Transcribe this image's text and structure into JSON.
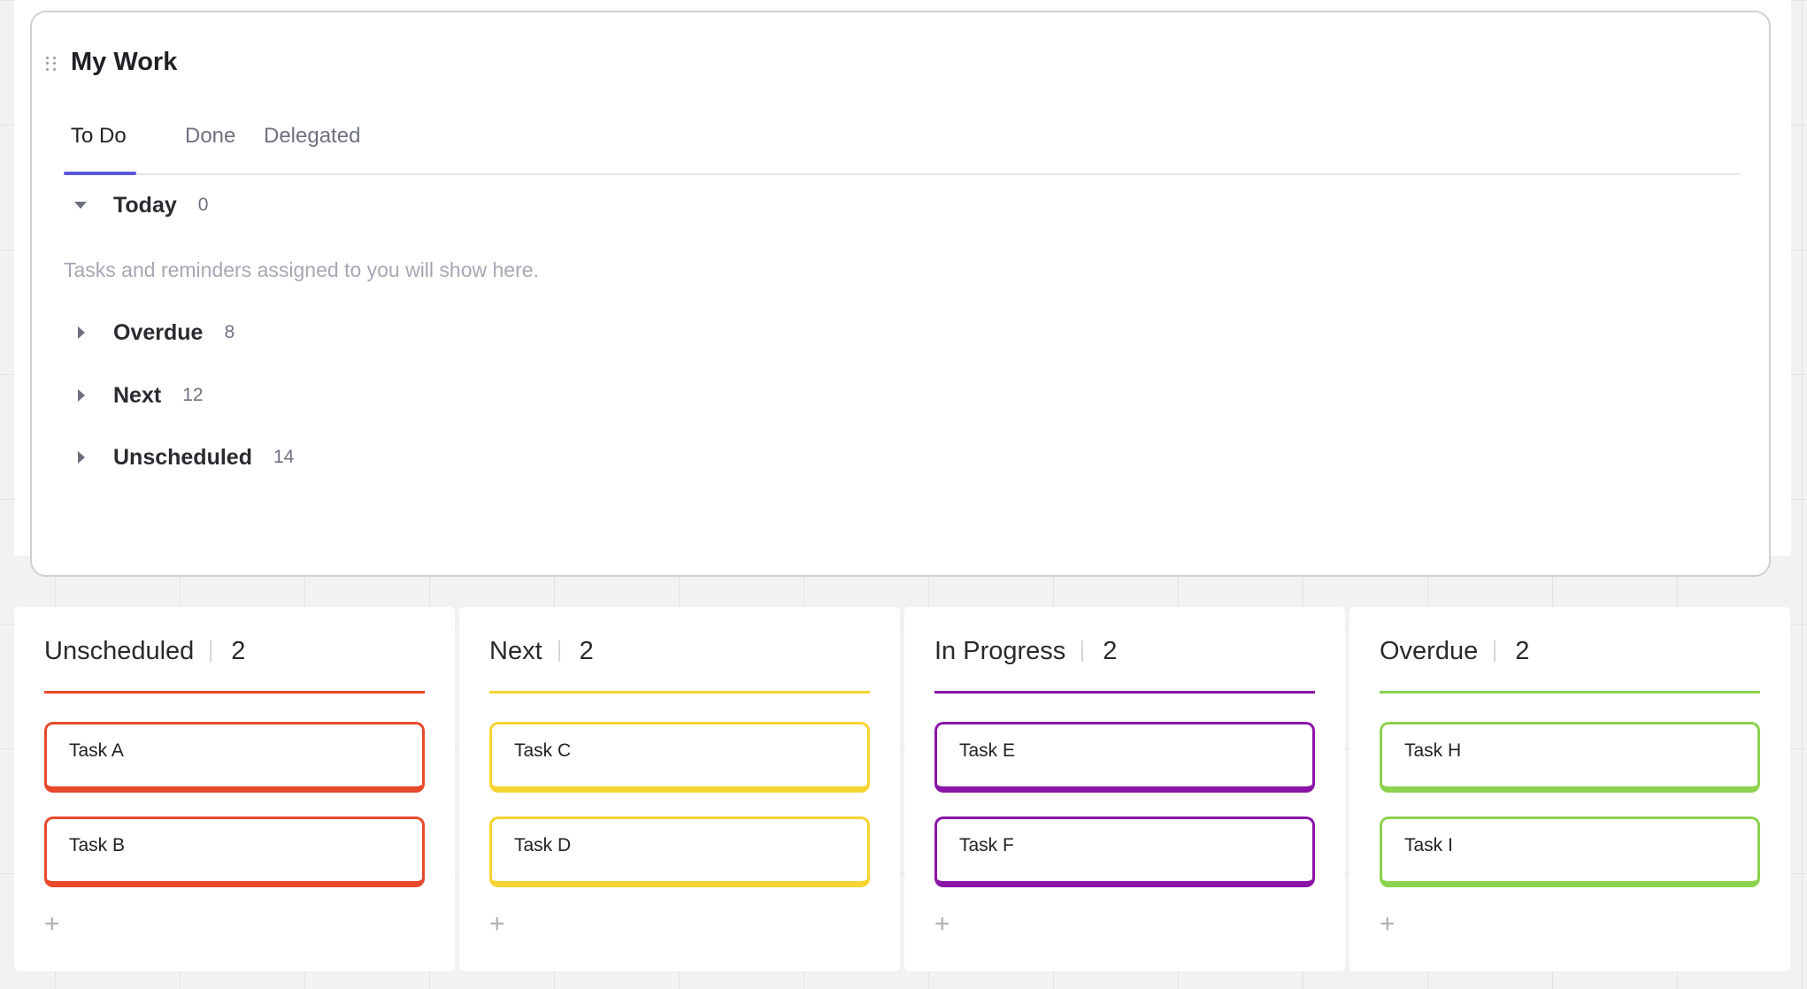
{
  "my_work": {
    "title": "My Work",
    "tabs": [
      {
        "label": "To Do",
        "active": true
      },
      {
        "label": "Done",
        "active": false
      },
      {
        "label": "Delegated",
        "active": false
      }
    ],
    "sections": [
      {
        "label": "Today",
        "count": "0",
        "expanded": true
      },
      {
        "label": "Overdue",
        "count": "8",
        "expanded": false
      },
      {
        "label": "Next",
        "count": "12",
        "expanded": false
      },
      {
        "label": "Unscheduled",
        "count": "14",
        "expanded": false
      }
    ],
    "empty_message": "Tasks and reminders assigned to you will show here."
  },
  "kanban": {
    "add_label": "+",
    "columns": [
      {
        "title": "Unscheduled",
        "count": "2",
        "color": "#e8492c",
        "cards": [
          "Task A",
          "Task B"
        ]
      },
      {
        "title": "Next",
        "count": "2",
        "color": "#f5d431",
        "cards": [
          "Task C",
          "Task D"
        ]
      },
      {
        "title": "In Progress",
        "count": "2",
        "color": "#8b14a8",
        "cards": [
          "Task E",
          "Task F"
        ]
      },
      {
        "title": "Overdue",
        "count": "2",
        "color": "#8cd24e",
        "cards": [
          "Task H",
          "Task I"
        ]
      }
    ]
  }
}
